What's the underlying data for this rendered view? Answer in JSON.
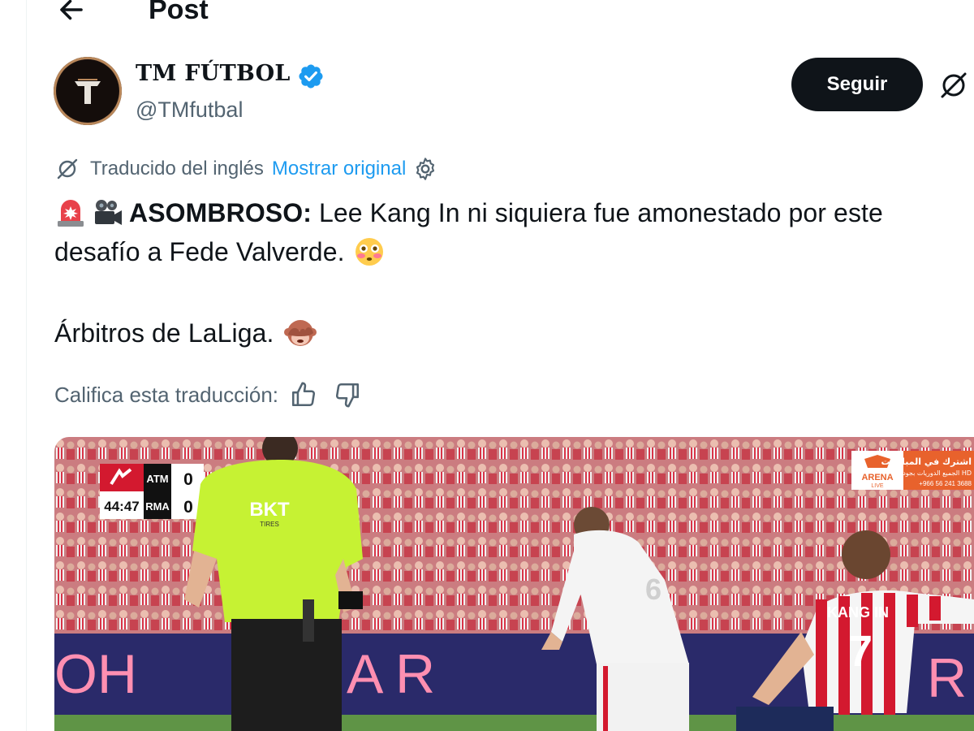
{
  "header": {
    "title": "Post",
    "back_icon": "arrow-left-icon"
  },
  "author": {
    "name": "TM FÚTBOL",
    "handle": "@TMfutbal",
    "avatar_letter": "T",
    "verified": true
  },
  "actions": {
    "follow_label": "Seguir",
    "grok_icon": "grok-icon"
  },
  "translation": {
    "label": "Traducido del inglés",
    "show_original": "Mostrar original",
    "settings_icon": "gear-icon"
  },
  "tweet": {
    "emoji_1": "🚨",
    "emoji_2": "🎥",
    "highlight": "ASOMBROSO:",
    "line1_rest": " Lee Kang In ni siquiera fue amonestado por este",
    "line2": "desafío a Fede Valverde.",
    "emoji_flushed": "😳",
    "line3": "Árbitros de LaLiga.",
    "emoji_monkey": "🙈"
  },
  "rating": {
    "label": "Califica esta traducción:",
    "thumbs_up_icon": "thumbs-up-icon",
    "thumbs_down_icon": "thumbs-down-icon"
  },
  "media": {
    "scoreboard": {
      "time": "44:47",
      "home": "ATM",
      "away": "RMA",
      "home_score": "0",
      "away_score": "0"
    },
    "referee_sponsor": "BKT",
    "referee_sponsor_sub": "TIRES",
    "player_name": "KANG IN",
    "player_number": "7",
    "opponent_number": "6",
    "board_left": "OH",
    "board_mid": "A",
    "board_right": "R",
    "board_far": "R",
    "broadcaster": "ARENA",
    "broadcaster_sub": "LIVE",
    "broadcaster_ar": "اشترك في المباريات",
    "broadcaster_ar2": "الجميع الدوريات بجودة HD",
    "broadcaster_phone": "+966 56 241 3688",
    "colors": {
      "crowd": "#c46a6f",
      "pitch": "#5f9446",
      "board": "#2a2a6a",
      "referee": "#c6f233",
      "atleti_red": "#d3192f"
    }
  }
}
